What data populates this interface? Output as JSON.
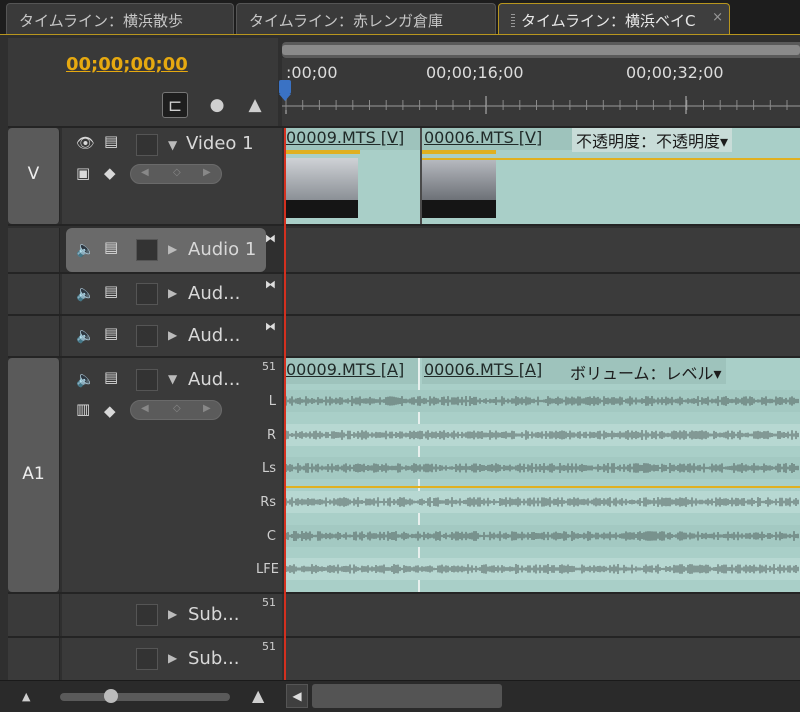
{
  "tabs": [
    {
      "label": "タイムライン：横浜散歩"
    },
    {
      "label": "タイムライン：赤レンガ倉庫"
    },
    {
      "label": "タイムライン：横浜ベイC",
      "close": "×"
    }
  ],
  "header": {
    "timecode": "00;00;00;00",
    "tools": {
      "snap_icon": "snap-icon",
      "marker_icon": "marker-icon",
      "keyframe_icon": "keyframe-icon"
    },
    "ruler_labels": [
      ":00;00",
      "00;00;16;00",
      "00;00;32;00"
    ]
  },
  "video_section": {
    "label": "V",
    "track": {
      "name": "Video 1",
      "clips": [
        {
          "title": "00009.MTS [V]"
        },
        {
          "title": "00006.MTS [V]",
          "effect": "不透明度：不透明度▾"
        }
      ]
    }
  },
  "audio_tracks_top": [
    {
      "name": "Audio 1"
    },
    {
      "name": "Aud..."
    },
    {
      "name": "Aud..."
    }
  ],
  "a1_section": {
    "label": "A1",
    "track": {
      "name": "Aud...",
      "format": "51",
      "channels": [
        "L",
        "R",
        "Ls",
        "Rs",
        "C",
        "LFE"
      ],
      "clips": [
        {
          "title": "00009.MTS [A]"
        },
        {
          "title": "00006.MTS [A]",
          "effect": "ボリューム：レベル▾"
        }
      ]
    }
  },
  "submix_tracks": [
    {
      "name": "Sub...",
      "format": "51"
    },
    {
      "name": "Sub...",
      "format": "51"
    }
  ],
  "colors": {
    "timecode": "#e6a910",
    "clip": "#a9cfc8",
    "playhead": "#d3301f",
    "accent": "#b8961e"
  }
}
